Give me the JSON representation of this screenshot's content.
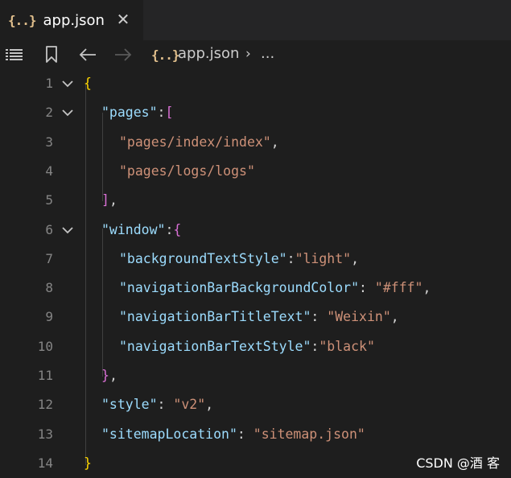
{
  "tab": {
    "label": "app.json",
    "icon": "braces-icon",
    "icon_text": "{..}",
    "close_glyph": "✕"
  },
  "toolbar": {
    "icons": [
      "list-icon",
      "bookmark-icon",
      "arrow-left-icon",
      "arrow-right-icon"
    ],
    "breadcrumb": {
      "icon_text": "{..}",
      "file": "app.json",
      "separator": "›",
      "more": "..."
    }
  },
  "editor": {
    "lines": [
      {
        "number": "1",
        "tokens": [
          {
            "t": "{",
            "c": "b1"
          }
        ]
      },
      {
        "number": "2",
        "tokens": [
          {
            "t": "\"pages\"",
            "c": "k"
          },
          {
            "t": ":",
            "c": "p"
          },
          {
            "t": "[",
            "c": "b2"
          }
        ]
      },
      {
        "number": "3",
        "tokens": [
          {
            "t": "\"pages/index/index\"",
            "c": "s"
          },
          {
            "t": ",",
            "c": "p"
          }
        ]
      },
      {
        "number": "4",
        "tokens": [
          {
            "t": "\"pages/logs/logs\"",
            "c": "s"
          }
        ]
      },
      {
        "number": "5",
        "tokens": [
          {
            "t": "]",
            "c": "b2"
          },
          {
            "t": ",",
            "c": "p"
          }
        ]
      },
      {
        "number": "6",
        "tokens": [
          {
            "t": "\"window\"",
            "c": "k"
          },
          {
            "t": ":",
            "c": "p"
          },
          {
            "t": "{",
            "c": "b2"
          }
        ]
      },
      {
        "number": "7",
        "tokens": [
          {
            "t": "\"backgroundTextStyle\"",
            "c": "k"
          },
          {
            "t": ":",
            "c": "p"
          },
          {
            "t": "\"light\"",
            "c": "s"
          },
          {
            "t": ",",
            "c": "p"
          }
        ]
      },
      {
        "number": "8",
        "tokens": [
          {
            "t": "\"navigationBarBackgroundColor\"",
            "c": "k"
          },
          {
            "t": ": ",
            "c": "p"
          },
          {
            "t": "\"#fff\"",
            "c": "s"
          },
          {
            "t": ",",
            "c": "p"
          }
        ]
      },
      {
        "number": "9",
        "tokens": [
          {
            "t": "\"navigationBarTitleText\"",
            "c": "k"
          },
          {
            "t": ": ",
            "c": "p"
          },
          {
            "t": "\"Weixin\"",
            "c": "s"
          },
          {
            "t": ",",
            "c": "p"
          }
        ]
      },
      {
        "number": "10",
        "tokens": [
          {
            "t": "\"navigationBarTextStyle\"",
            "c": "k"
          },
          {
            "t": ":",
            "c": "p"
          },
          {
            "t": "\"black\"",
            "c": "s"
          }
        ]
      },
      {
        "number": "11",
        "tokens": [
          {
            "t": "}",
            "c": "b2"
          },
          {
            "t": ",",
            "c": "p"
          }
        ]
      },
      {
        "number": "12",
        "tokens": [
          {
            "t": "\"style\"",
            "c": "k"
          },
          {
            "t": ": ",
            "c": "p"
          },
          {
            "t": "\"v2\"",
            "c": "s"
          },
          {
            "t": ",",
            "c": "p"
          }
        ]
      },
      {
        "number": "13",
        "tokens": [
          {
            "t": "\"sitemapLocation\"",
            "c": "k"
          },
          {
            "t": ": ",
            "c": "p"
          },
          {
            "t": "\"sitemap.json\"",
            "c": "s"
          }
        ]
      },
      {
        "number": "14",
        "tokens": [
          {
            "t": "}",
            "c": "b1"
          }
        ]
      }
    ]
  },
  "watermark": "CSDN @酒 客",
  "colors": {
    "background": "#1e1e1e",
    "tabbar": "#252526",
    "key": "#9cdcfe",
    "string": "#ce9178",
    "bracket_outer": "#ffd700",
    "bracket_inner": "#da70d6",
    "line_number": "#858585",
    "json_icon": "#e2c08d"
  }
}
